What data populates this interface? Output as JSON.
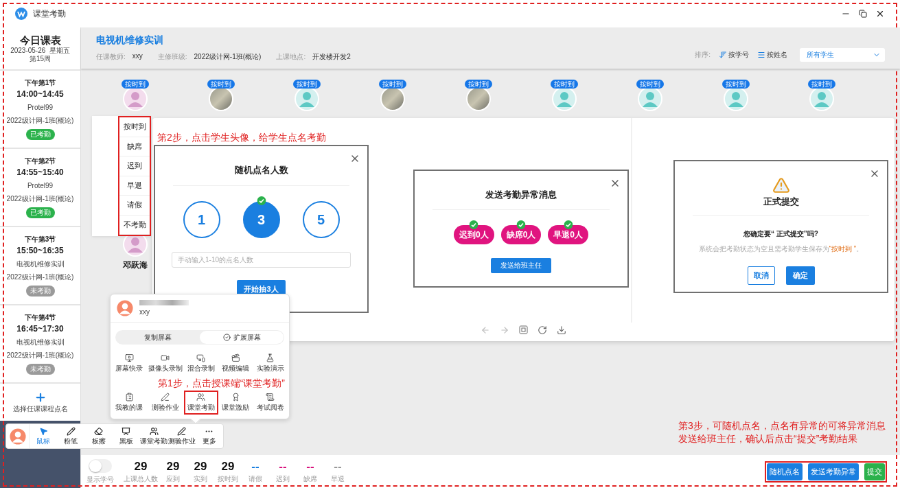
{
  "window": {
    "title": "课堂考勤"
  },
  "schedule": {
    "title": "今日课表",
    "date": "2023-05-26  星期五",
    "week": "第15周",
    "add_label": "选择任课课程点名",
    "sessions": [
      {
        "period": "下午第1节",
        "time": "14:00~14:45",
        "course": "Protel99",
        "class": "2022级计网-1班(概论)",
        "status": "已考勤",
        "done": true
      },
      {
        "period": "下午第2节",
        "time": "14:55~15:40",
        "course": "Protel99",
        "class": "2022级计网-1班(概论)",
        "status": "已考勤",
        "done": true
      },
      {
        "period": "下午第3节",
        "time": "15:50~16:35",
        "course": "电视机维修实训",
        "class": "2022级计网-1班(概论)",
        "status": "未考勤",
        "done": false
      },
      {
        "period": "下午第4节",
        "time": "16:45~17:30",
        "course": "电视机维修实训",
        "class": "2022级计网-1班(概论)",
        "status": "未考勤",
        "done": false
      }
    ]
  },
  "course": {
    "title": "电视机维修实训",
    "info": [
      {
        "label": "任课教师:",
        "value": "xxy"
      },
      {
        "label": "主修班级:",
        "value": "2022级计网-1班(概论)"
      },
      {
        "label": "上课地点:",
        "value": "开发楼开发2"
      }
    ]
  },
  "sort": {
    "label": "排序:",
    "options": [
      "按学号",
      "按姓名"
    ],
    "filter": "所有学生"
  },
  "students": [
    {
      "badge": "按时到",
      "kind": "female"
    },
    {
      "badge": "按时到",
      "kind": "photo"
    },
    {
      "badge": "按时到",
      "kind": "default"
    },
    {
      "badge": "按时到",
      "kind": "photo"
    },
    {
      "badge": "按时到",
      "kind": "photo"
    },
    {
      "badge": "按时到",
      "kind": "default"
    },
    {
      "badge": "按时到",
      "kind": "default"
    },
    {
      "badge": "按时到",
      "kind": "default"
    },
    {
      "badge": "按时到",
      "kind": "default"
    },
    {
      "kind": "female",
      "name": "邓跃海"
    }
  ],
  "status_menu": [
    "按时到",
    "缺席",
    "迟到",
    "早退",
    "请假",
    "不考勤"
  ],
  "random_dialog": {
    "title": "随机点名人数",
    "options": [
      {
        "label": "1",
        "selected": false
      },
      {
        "label": "3",
        "selected": true
      },
      {
        "label": "5",
        "selected": false
      }
    ],
    "placeholder": "手动输入1-10的点名人数",
    "button": "开始抽3人"
  },
  "notify_dialog": {
    "title": "发送考勤异常消息",
    "chips": [
      {
        "label": "迟到0人",
        "checked": true
      },
      {
        "label": "缺席0人",
        "checked": true
      },
      {
        "label": "早退0人",
        "checked": true
      }
    ],
    "button": "发送给班主任"
  },
  "submit_dialog": {
    "title": "正式提交",
    "question": "您确定要“ 正式提交”吗?",
    "note_before": "系统会把考勤状态为空且需考勤学生保存为",
    "note_highlight": "“按时到 ”",
    "note_after": "。",
    "cancel": "取消",
    "confirm": "确定"
  },
  "teacher_popup": {
    "name": "xxy",
    "screen_modes": [
      {
        "label": "复制屏幕",
        "selected": false
      },
      {
        "label": "扩展屏幕",
        "selected": true
      }
    ],
    "tools": [
      {
        "label": "屏幕快录",
        "highlighted": false
      },
      {
        "label": "摄像头录制",
        "highlighted": false
      },
      {
        "label": "混合录制",
        "highlighted": false
      },
      {
        "label": "视频编辑",
        "highlighted": false
      },
      {
        "label": "实验演示",
        "highlighted": false
      },
      {
        "label": "我教的课",
        "highlighted": false
      },
      {
        "label": "测验作业",
        "highlighted": false
      },
      {
        "label": "课堂考勤",
        "highlighted": true
      },
      {
        "label": "课堂激励",
        "highlighted": false
      },
      {
        "label": "考试阅卷",
        "highlighted": false
      }
    ]
  },
  "toolbar": [
    {
      "label": "鼠标",
      "selected": true
    },
    {
      "label": "粉笔",
      "selected": false
    },
    {
      "label": "板擦",
      "selected": false
    },
    {
      "label": "黑板",
      "selected": false
    },
    {
      "label": "课堂考勤",
      "selected": false
    },
    {
      "label": "测验作业",
      "selected": false
    },
    {
      "label": "更多",
      "selected": false
    }
  ],
  "stats": {
    "toggle_label": "显示学号",
    "toggle_on": false,
    "items": [
      {
        "value": "29",
        "label": "上课总人数",
        "color": "#111111"
      },
      {
        "value": "29",
        "label": "应到",
        "color": "#111111"
      },
      {
        "value": "29",
        "label": "实到",
        "color": "#111111"
      },
      {
        "value": "29",
        "label": "按时到",
        "color": "#111111"
      },
      {
        "value": "--",
        "label": "请假",
        "color": "#1a7fe0"
      },
      {
        "value": "--",
        "label": "迟到",
        "color": "#d8127d"
      },
      {
        "value": "--",
        "label": "缺席",
        "color": "#d8127d"
      },
      {
        "value": "--",
        "label": "早退",
        "color": "#999999"
      }
    ]
  },
  "actions": [
    {
      "label": "随机点名",
      "kind": "primary"
    },
    {
      "label": "发送考勤异常",
      "kind": "primary"
    },
    {
      "label": "提交",
      "kind": "success"
    }
  ],
  "annotations": {
    "step1": "第1步，点击授课端“课堂考勤”",
    "step2": "第2步，点击学生头像，给学生点名考勤",
    "step3": "第3步，可随机点名，点名有异常的可将异常消息发送给班主任，确认后点击“提交”考勤结果"
  }
}
